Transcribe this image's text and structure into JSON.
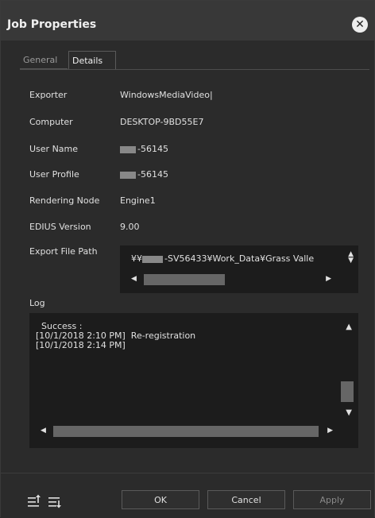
{
  "window": {
    "title": "Job Properties"
  },
  "tabs": {
    "general": "General",
    "details": "Details"
  },
  "details": {
    "exporter": {
      "label": "Exporter",
      "value": "WindowsMediaVideo"
    },
    "computer": {
      "label": "Computer",
      "value": "DESKTOP-9BD55E7"
    },
    "user_name": {
      "label": "User Name",
      "value": "-56145"
    },
    "user_profile": {
      "label": "User Profile",
      "value": "-56145"
    },
    "rendering_node": {
      "label": "Rendering Node",
      "value": "Engine1"
    },
    "edius_version": {
      "label": "EDIUS Version",
      "value": "9.00"
    },
    "export_file_path": {
      "label": "Export File Path",
      "value_prefix": "¥¥",
      "value_suffix": "-SV56433¥Work_Data¥Grass Valle"
    }
  },
  "log": {
    "label": "Log",
    "lines": [
      "  Success :",
      "[10/1/2018 2:10 PM]  Re-registration",
      "[10/1/2018 2:14 PM]"
    ]
  },
  "footer": {
    "ok": "OK",
    "cancel": "Cancel",
    "apply": "Apply"
  },
  "icons": {
    "move_up": "list-move-up-icon",
    "move_down": "list-move-down-icon",
    "close": "close-icon"
  }
}
